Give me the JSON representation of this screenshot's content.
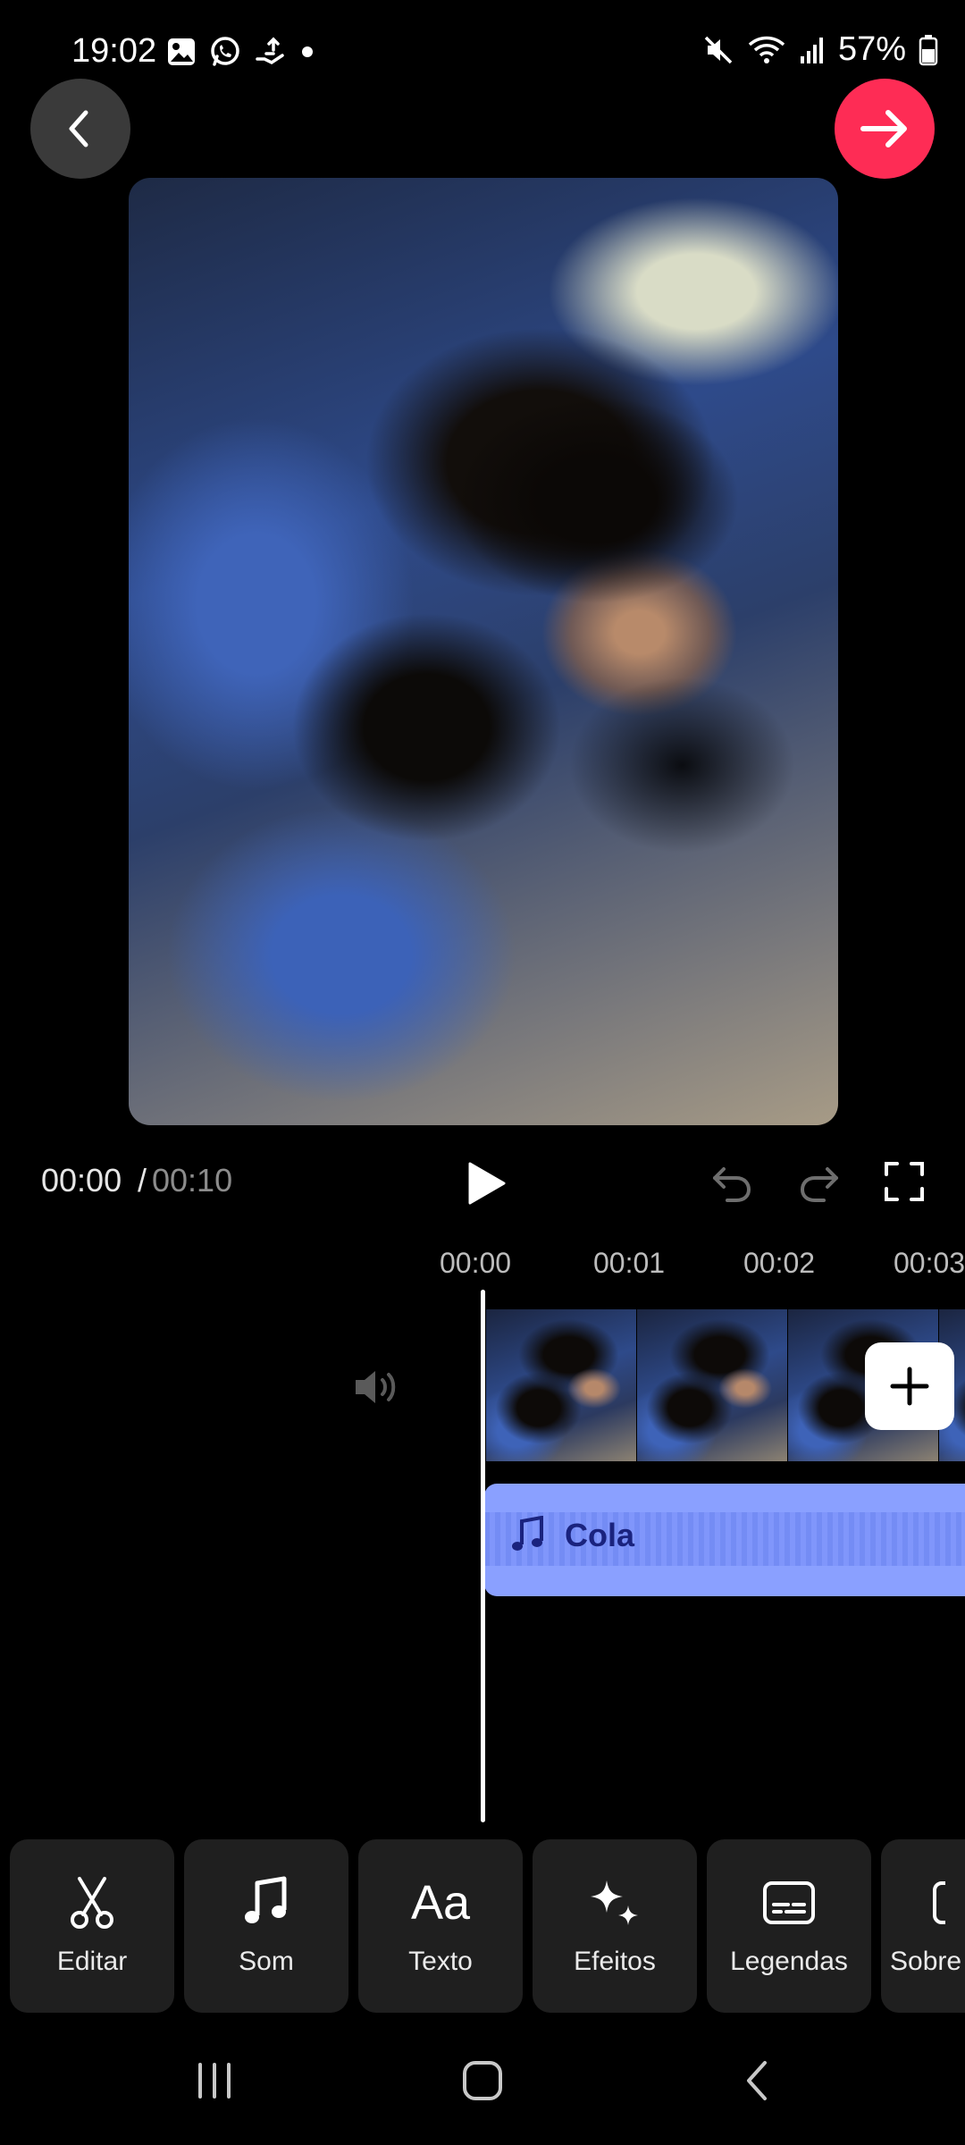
{
  "status_bar": {
    "time": "19:02",
    "battery": "57%",
    "left_icons": [
      "gallery-icon",
      "whatsapp-icon",
      "hand-icon",
      "dot-icon"
    ],
    "right_icons": [
      "mute-icon",
      "wifi-icon",
      "signal-icon",
      "battery-icon"
    ]
  },
  "header": {
    "back_icon": "chevron-left-icon",
    "next_icon": "arrow-right-icon",
    "next_color": "#fe2c55"
  },
  "playback": {
    "current_time": "00:00",
    "separator": "/",
    "total_time": "00:10"
  },
  "timeline": {
    "ticks": [
      "00:00",
      "00:01",
      "00:02",
      "00:03"
    ],
    "audio_track": {
      "name": "Cola",
      "color": "#8aa0ff"
    }
  },
  "toolbar": {
    "items": [
      {
        "label": "Editar",
        "icon": "scissors-icon"
      },
      {
        "label": "Som",
        "icon": "music-note-icon"
      },
      {
        "label": "Texto",
        "icon": "text-aa-icon",
        "icon_text": "Aa"
      },
      {
        "label": "Efeitos",
        "icon": "sparkles-icon"
      },
      {
        "label": "Legendas",
        "icon": "captions-icon"
      },
      {
        "label": "Sobre",
        "icon": "overlay-icon"
      }
    ]
  },
  "nav_bar": {
    "items": [
      "recents-icon",
      "home-icon",
      "back-icon"
    ]
  }
}
